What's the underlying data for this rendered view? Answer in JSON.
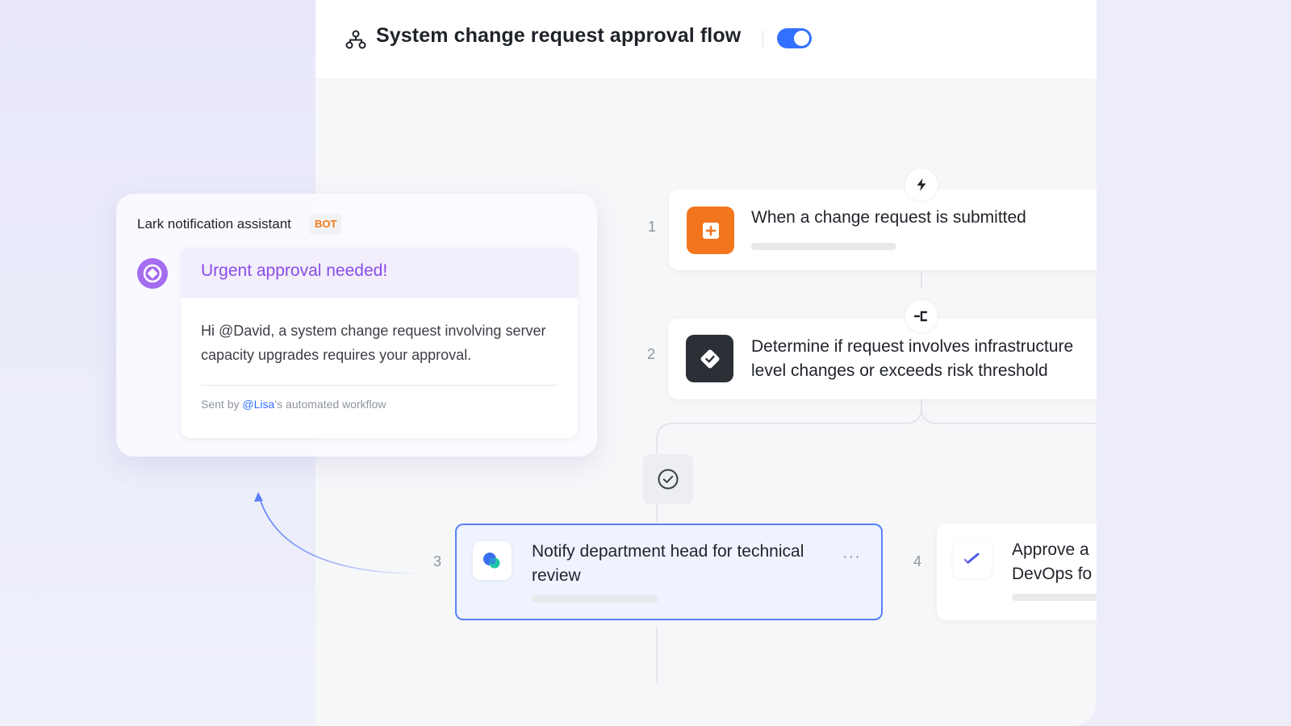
{
  "flow": {
    "title": "System change request approval flow",
    "enabled": true
  },
  "steps": [
    {
      "number": "1",
      "title": "When a change request is submitted",
      "badge_icon": "lightning-icon",
      "icon": "plus-square-icon",
      "icon_color": "#f3761f"
    },
    {
      "number": "2",
      "title_line1": "Determine if request involves infrastructure",
      "title_line2": "level changes or exceeds risk threshold",
      "badge_icon": "branch-icon",
      "icon": "diamond-check-icon",
      "icon_color": "#2b2f36"
    },
    {
      "number": "3",
      "title_line1": "Notify department head for technical",
      "title_line2": "review",
      "icon": "chat-bubbles-icon",
      "more": "···"
    },
    {
      "number": "4",
      "title_line1": "Approve a",
      "title_line2": "DevOps fo",
      "icon": "double-check-icon"
    }
  ],
  "notification": {
    "assistant_name": "Lark notification assistant",
    "badge": "BOT",
    "header": "Urgent approval needed!",
    "body": "Hi @David, a system change request involving server capacity upgrades requires your approval.",
    "footer_prefix": "Sent by ",
    "footer_mention": "@Lisa",
    "footer_suffix": "’s automated workflow"
  },
  "colors": {
    "accent_blue": "#3370ff",
    "accent_purple": "#8a4ce6",
    "accent_orange": "#f3761f"
  }
}
